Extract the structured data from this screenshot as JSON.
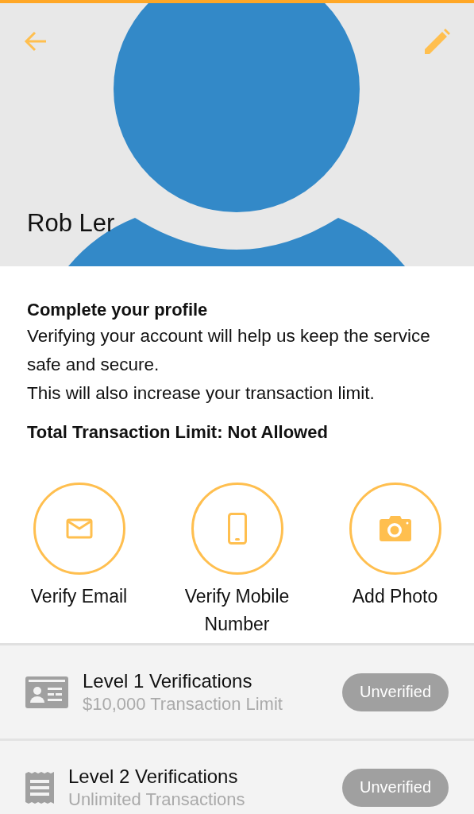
{
  "header": {
    "name": "Rob Ler"
  },
  "profile": {
    "title": "Complete your profile",
    "lines": [
      "Verifying your account will help us keep the service safe and secure.",
      "This will also increase your transaction limit."
    ],
    "limit": "Total Transaction Limit: Not Allowed"
  },
  "actions": [
    {
      "kind": "email",
      "label": "Verify Email"
    },
    {
      "kind": "mobile",
      "label": "Verify Mobile Number"
    },
    {
      "kind": "photo",
      "label": "Add Photo"
    }
  ],
  "levels": [
    {
      "kind": "id",
      "title": "Level 1 Verifications",
      "subtitle": "$10,000 Transaction Limit",
      "status": "Unverified",
      "verified": false
    },
    {
      "kind": "receipt",
      "title": "Level 2 Verifications",
      "subtitle": "Unlimited Transactions",
      "status": "Unverified",
      "verified": false
    }
  ]
}
